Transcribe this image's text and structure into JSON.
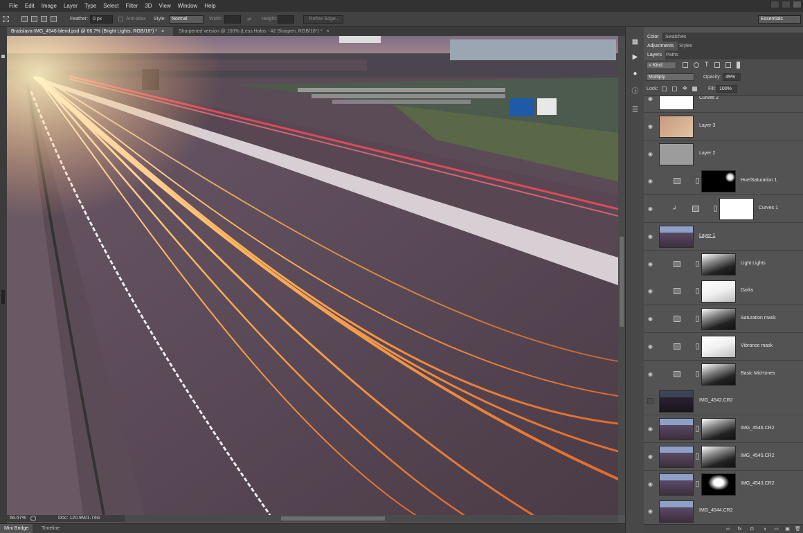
{
  "menubar": {
    "items": [
      "File",
      "Edit",
      "Image",
      "Layer",
      "Type",
      "Select",
      "Filter",
      "3D",
      "View",
      "Window",
      "Help"
    ]
  },
  "options_bar": {
    "feather_label": "Feather:",
    "feather_value": "0 px",
    "antialias_label": "Anti-alias",
    "style_label": "Style:",
    "style_value": "Normal",
    "width_label": "Width:",
    "height_label": "Height:",
    "refine_edge": "Refine Edge...",
    "workspace": "Essentials"
  },
  "tabs": [
    {
      "label": "Bratislava-IMG_4546-blend.psd @ 66.7% (Bright Lights, RGB/16*) *",
      "close": "×"
    },
    {
      "label": "Sharpened version @ 100% (Less Halos - #2 Sharpen, RGB/16*) *",
      "close": "×"
    }
  ],
  "status": {
    "zoom": "66.67%",
    "doc": "Doc: 120.9M/1.74G"
  },
  "bottom_tabs": [
    "Mini Bridge",
    "Timeline"
  ],
  "panels": {
    "top_tabs": [
      "Color",
      "Swatches"
    ],
    "mid_tabs": [
      "Adjustments",
      "Styles"
    ],
    "layer_tabs": [
      "Layers",
      "Paths"
    ],
    "kind_label": "Kind",
    "blend_mode": "Multiply",
    "opacity_label": "Opacity:",
    "opacity_value": "49%",
    "lock_label": "Lock:",
    "fill_label": "Fill:",
    "fill_value": "100%"
  },
  "layers": [
    {
      "name": "Curves 2",
      "thumb": "white-partial"
    },
    {
      "name": "Layer 3",
      "thumb": "orange"
    },
    {
      "name": "Layer 2",
      "thumb": "gray"
    },
    {
      "name": "Hue/Saturation 1",
      "thumb": "black-white-corner",
      "adjustment": true
    },
    {
      "name": "Curves 1",
      "thumb": "white",
      "adjustment": true,
      "clipped": true
    },
    {
      "name": "Layer 1",
      "thumb": "photo",
      "underlined": true
    },
    {
      "name": "Light Lights",
      "thumb": "bw-photo",
      "adjustment": true
    },
    {
      "name": "Darks",
      "thumb": "white-photo",
      "adjustment": true
    },
    {
      "name": "Saturation mask",
      "thumb": "bw-photo",
      "adjustment": true
    },
    {
      "name": "Vibrance mask",
      "thumb": "white-photo",
      "adjustment": true
    },
    {
      "name": "Basic Mid-tones",
      "thumb": "bw-photo",
      "adjustment": true
    },
    {
      "name": "IMG_4542.CR2",
      "thumb": "dark-photo",
      "hidden": true
    },
    {
      "name": "IMG_4546.CR2",
      "thumb": "photo",
      "mask": "bw-photo"
    },
    {
      "name": "IMG_4545.CR2",
      "thumb": "photo",
      "mask": "bw-photo"
    },
    {
      "name": "IMG_4543.CR2",
      "thumb": "photo",
      "mask": "black-white-center"
    },
    {
      "name": "IMG_4544.CR2",
      "thumb": "photo"
    }
  ]
}
